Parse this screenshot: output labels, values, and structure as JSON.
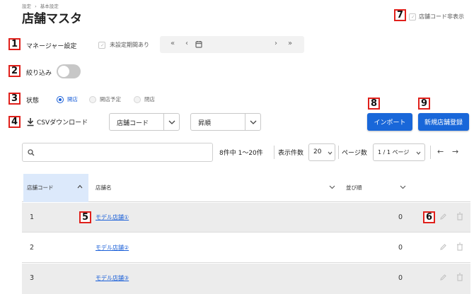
{
  "breadcrumb": {
    "items": [
      "設定",
      "基本設定"
    ],
    "separator": "›"
  },
  "page": {
    "title": "店舗マスタ"
  },
  "markers": [
    "1",
    "2",
    "3",
    "4",
    "5",
    "6",
    "7",
    "8",
    "9"
  ],
  "hide_code": {
    "label": "店舗コード非表示",
    "checked": true
  },
  "manager": {
    "label": "マネージャー設定",
    "unset_label": "未設定期間あり",
    "nav": {
      "first": "«",
      "prev": "‹",
      "next": "›",
      "last": "»"
    }
  },
  "filter": {
    "label": "絞り込み",
    "on": false
  },
  "status": {
    "label": "状態",
    "options": [
      {
        "label": "開店",
        "selected": true
      },
      {
        "label": "開店予定",
        "selected": false
      },
      {
        "label": "閉店",
        "selected": false
      }
    ]
  },
  "csv": {
    "label": "CSVダウンロード"
  },
  "sort": {
    "field": "店舗コード",
    "order": "昇順"
  },
  "buttons": {
    "import": "インポート",
    "new_store": "新規店舗登録"
  },
  "listing": {
    "count_text": "8件中 1～20件",
    "per_page_label": "表示件数",
    "per_page": "20",
    "pages_label": "ページ数",
    "page_value": "1 / 1 ページ",
    "prev_arrow": "←",
    "next_arrow": "→"
  },
  "table": {
    "headers": {
      "code": "店舗コード",
      "name": "店舗名",
      "order": "並び順"
    },
    "rows": [
      {
        "code": "1",
        "name": "モデル店舗①",
        "order": "0"
      },
      {
        "code": "2",
        "name": "モデル店舗②",
        "order": "0"
      },
      {
        "code": "3",
        "name": "モデル店舗③",
        "order": "0"
      }
    ]
  },
  "colors": {
    "accent": "#1967d9",
    "marker_border": "#e0201b",
    "highlight_header": "#dce9fb"
  }
}
